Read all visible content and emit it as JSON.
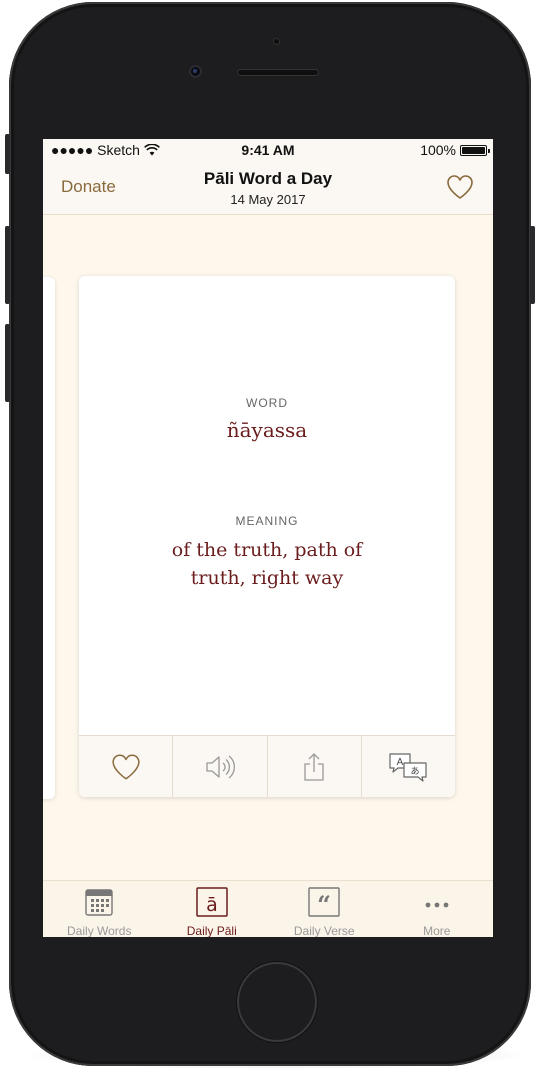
{
  "status_bar": {
    "carrier": "●●●●● Sketch",
    "time": "9:41 AM",
    "battery": "100%"
  },
  "nav": {
    "donate_label": "Donate",
    "title": "Pāli Word a Day",
    "date": "14 May 2017",
    "favorite_icon": "heart-icon"
  },
  "card": {
    "word_label": "WORD",
    "word": "ñāyassa",
    "meaning_label": "MEANING",
    "meaning_line1": "of the truth, path of",
    "meaning_line2": "truth, right way",
    "actions": [
      {
        "icon": "heart-icon"
      },
      {
        "icon": "speaker-icon"
      },
      {
        "icon": "share-icon"
      },
      {
        "icon": "translate-icon"
      }
    ]
  },
  "tabs": [
    {
      "label": "Daily Words",
      "icon": "calendar-icon"
    },
    {
      "label": "Daily Pāli",
      "icon": "pali-a-icon",
      "active": true
    },
    {
      "label": "Daily Verse",
      "icon": "quote-icon"
    },
    {
      "label": "More",
      "icon": "more-dots-icon"
    }
  ],
  "colors": {
    "accent": "#6b1d1d",
    "gold": "#8a6a3c",
    "background": "#fdf7ec"
  }
}
